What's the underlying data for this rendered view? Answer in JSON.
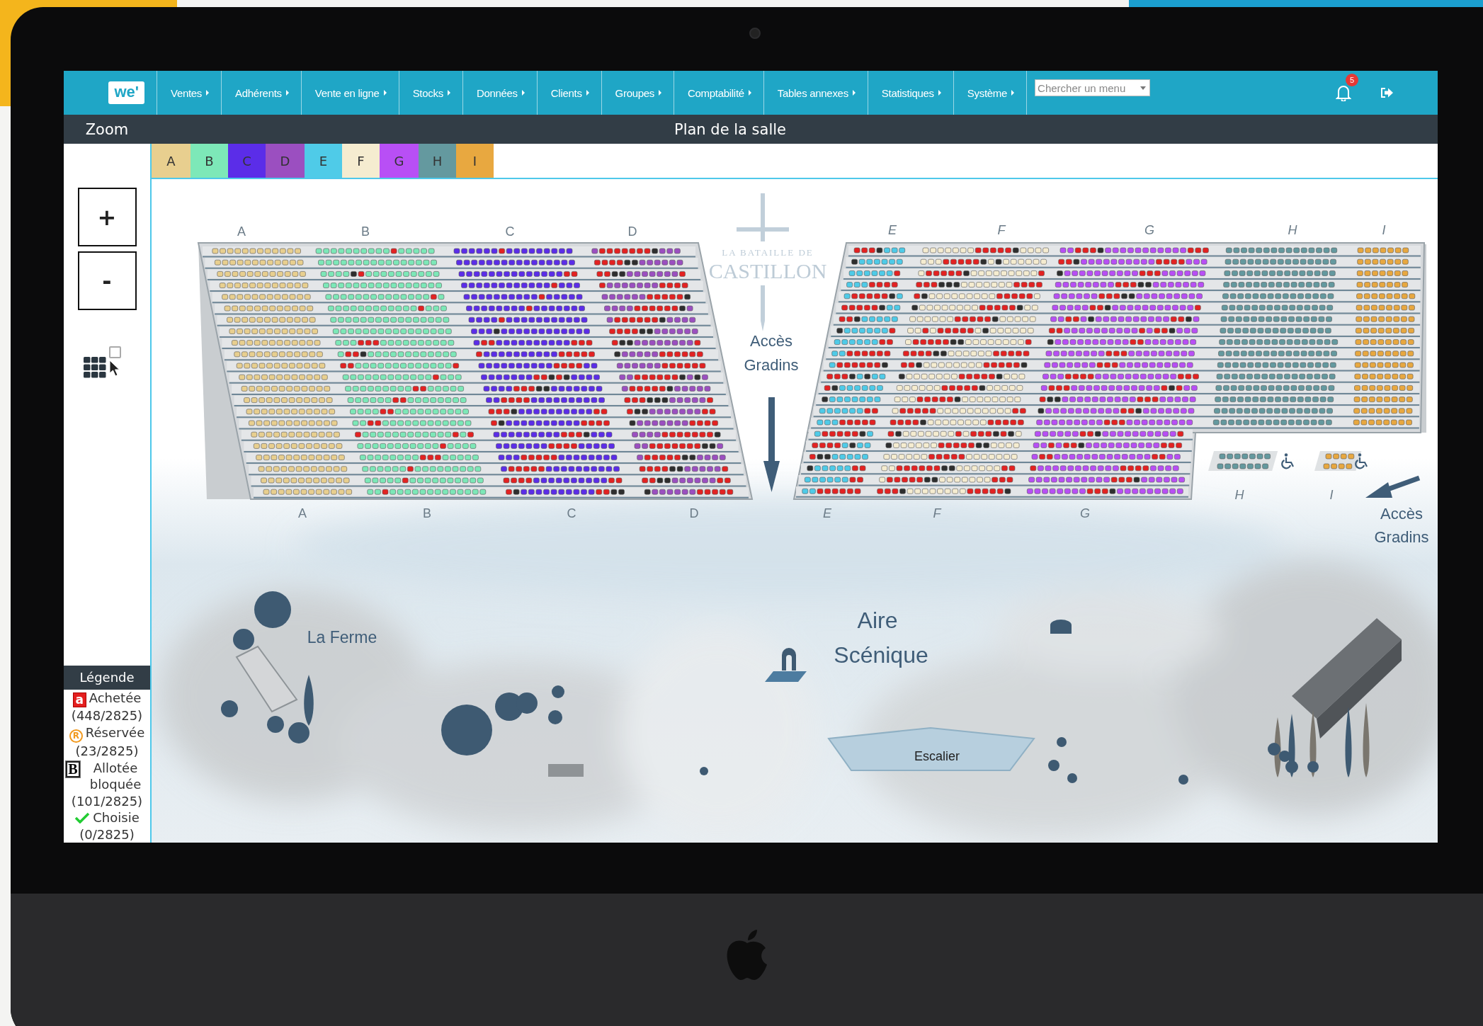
{
  "nav": {
    "logo": "we'",
    "menus": [
      {
        "label": "Ventes"
      },
      {
        "label": "Adhérents"
      },
      {
        "label": "Vente en ligne"
      },
      {
        "label": "Stocks"
      },
      {
        "label": "Données"
      },
      {
        "label": "Clients"
      },
      {
        "label": "Groupes"
      },
      {
        "label": "Comptabilité"
      },
      {
        "label": "Tables annexes"
      },
      {
        "label": "Statistiques"
      },
      {
        "label": "Système"
      }
    ],
    "search": {
      "placeholder": "Chercher un menu"
    },
    "notification_count": "5"
  },
  "title_bar": {
    "left": "Zoom",
    "title": "Plan de la salle"
  },
  "sections": [
    {
      "label": "A",
      "color": "#e8cf8f"
    },
    {
      "label": "B",
      "color": "#7de8b8"
    },
    {
      "label": "C",
      "color": "#5b2de8"
    },
    {
      "label": "D",
      "color": "#9b4fc0"
    },
    {
      "label": "E",
      "color": "#4fcbe8"
    },
    {
      "label": "F",
      "color": "#f5ecd0"
    },
    {
      "label": "G",
      "color": "#b84ff5"
    },
    {
      "label": "H",
      "color": "#64999f"
    },
    {
      "label": "I",
      "color": "#e8a840"
    }
  ],
  "zoom_controls": {
    "zoom_in": "+",
    "zoom_out": "-"
  },
  "selection_tool": {
    "checked": false
  },
  "legend": {
    "title": "Légende",
    "items": [
      {
        "kind": "purchased",
        "symbol": "a",
        "label": "Achetée",
        "count": "(448/2825)"
      },
      {
        "kind": "reserved",
        "symbol": "R",
        "label": "Réservée",
        "count": "(23/2825)"
      },
      {
        "kind": "blocked",
        "symbol": "B",
        "label": "Allotée bloquée",
        "count": "(101/2825)"
      },
      {
        "kind": "chosen",
        "label": "Choisie",
        "count": "(0/2825)"
      }
    ]
  },
  "plan": {
    "logo_lines": [
      "LA BATAILLE DE",
      "CASTILLON"
    ],
    "left_labels_top": [
      "A",
      "B",
      "C",
      "D"
    ],
    "left_labels_bottom": [
      "A",
      "B",
      "C",
      "D"
    ],
    "right_labels_top": [
      "E",
      "F",
      "G",
      "H",
      "I"
    ],
    "right_labels_bottom": [
      "E",
      "F",
      "G"
    ],
    "accessible_labels": [
      "H",
      "I"
    ],
    "access_center": [
      "Accès",
      "Gradins"
    ],
    "access_right": [
      "Accès",
      "Gradins"
    ],
    "areas": {
      "farm": "La Ferme",
      "stage": [
        "Aire",
        "Scénique"
      ],
      "stairs": "Escalier"
    }
  }
}
